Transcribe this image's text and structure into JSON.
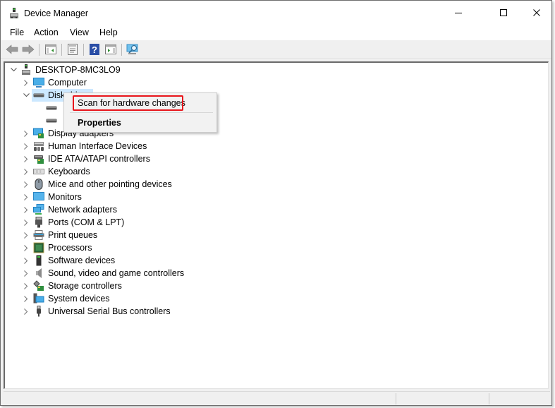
{
  "window": {
    "title": "Device Manager",
    "controls": {
      "minimize": "minimize",
      "maximize": "maximize",
      "close": "close"
    }
  },
  "menubar": {
    "items": [
      {
        "label": "File"
      },
      {
        "label": "Action"
      },
      {
        "label": "View"
      },
      {
        "label": "Help"
      }
    ]
  },
  "toolbar": {
    "buttons": [
      {
        "icon": "back-arrow-icon"
      },
      {
        "icon": "forward-arrow-icon"
      },
      {
        "icon": "show-hide-console-tree-icon"
      },
      {
        "icon": "properties-icon"
      },
      {
        "icon": "help-icon"
      },
      {
        "icon": "show-hide-action-pane-icon"
      },
      {
        "icon": "scan-hardware-icon"
      }
    ]
  },
  "tree": {
    "root": {
      "label": "DESKTOP-8MC3LO9",
      "expanded": true
    },
    "categories": [
      {
        "label": "Computer",
        "expanded": false,
        "icon": "computer-icon"
      },
      {
        "label": "Disk drives",
        "expanded": true,
        "selected": true,
        "icon": "disk-drive-icon",
        "children": [
          {
            "label": "",
            "icon": "disk-drive-icon"
          },
          {
            "label": "",
            "icon": "disk-drive-icon"
          }
        ]
      },
      {
        "label": "Display adapters",
        "expanded": false,
        "icon": "display-adapter-icon"
      },
      {
        "label": "Human Interface Devices",
        "expanded": false,
        "icon": "hid-icon"
      },
      {
        "label": "IDE ATA/ATAPI controllers",
        "expanded": false,
        "icon": "ide-controller-icon"
      },
      {
        "label": "Keyboards",
        "expanded": false,
        "icon": "keyboard-icon"
      },
      {
        "label": "Mice and other pointing devices",
        "expanded": false,
        "icon": "mouse-icon"
      },
      {
        "label": "Monitors",
        "expanded": false,
        "icon": "monitor-icon"
      },
      {
        "label": "Network adapters",
        "expanded": false,
        "icon": "network-adapter-icon"
      },
      {
        "label": "Ports (COM & LPT)",
        "expanded": false,
        "icon": "port-icon"
      },
      {
        "label": "Print queues",
        "expanded": false,
        "icon": "printer-icon"
      },
      {
        "label": "Processors",
        "expanded": false,
        "icon": "processor-icon"
      },
      {
        "label": "Software devices",
        "expanded": false,
        "icon": "software-device-icon"
      },
      {
        "label": "Sound, video and game controllers",
        "expanded": false,
        "icon": "speaker-icon"
      },
      {
        "label": "Storage controllers",
        "expanded": false,
        "icon": "storage-controller-icon"
      },
      {
        "label": "System devices",
        "expanded": false,
        "icon": "system-device-icon"
      },
      {
        "label": "Universal Serial Bus controllers",
        "expanded": false,
        "icon": "usb-icon"
      }
    ]
  },
  "context_menu": {
    "items": [
      {
        "label": "Scan for hardware changes",
        "highlighted": true
      },
      {
        "label": "Properties",
        "bold": true
      }
    ],
    "highlight_color": "#e8151b"
  },
  "colors": {
    "selection": "#cce8ff",
    "window_bg": "#f0f0f0",
    "tree_bg": "#ffffff"
  }
}
